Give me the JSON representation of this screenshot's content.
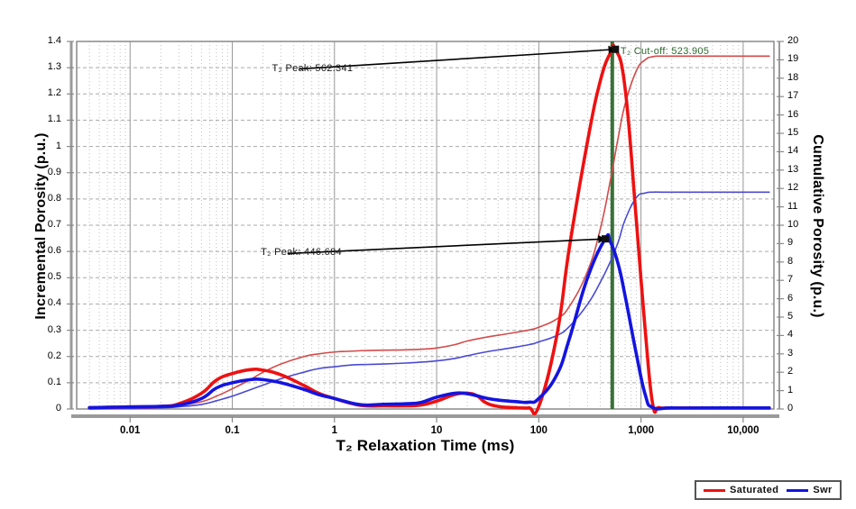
{
  "chart_data": {
    "type": "line",
    "title": "",
    "xlabel": "T₂ Relaxation Time (ms)",
    "ylabel": "Incremental Porosity (p.u.)",
    "ylabel_right": "Cumulative Porosity (p.u.)",
    "xscale": "log",
    "xlim": [
      0.003,
      20000
    ],
    "ylim": [
      0,
      1.4
    ],
    "ylim_right": [
      0,
      20
    ],
    "grid": true,
    "legend_position": "bottom-right",
    "xtick_labels": [
      "0.01",
      "0.1",
      "1",
      "10",
      "100",
      "1,000",
      "10,000"
    ],
    "xtick_values": [
      0.01,
      0.1,
      1,
      10,
      100,
      1000,
      10000
    ],
    "ytick_labels_left": [
      "0",
      "0.1",
      "0.2",
      "0.3",
      "0.4",
      "0.5",
      "0.6",
      "0.7",
      "0.8",
      "0.9",
      "1",
      "1.1",
      "1.2",
      "1.3",
      "1.4"
    ],
    "ytick_values_left": [
      0,
      0.1,
      0.2,
      0.3,
      0.4,
      0.5,
      0.6,
      0.7,
      0.8,
      0.9,
      1.0,
      1.1,
      1.2,
      1.3,
      1.4
    ],
    "ytick_labels_right": [
      "0",
      "1",
      "2",
      "3",
      "4",
      "5",
      "6",
      "7",
      "8",
      "9",
      "10",
      "11",
      "12",
      "13",
      "14",
      "15",
      "16",
      "17",
      "18",
      "19",
      "20"
    ],
    "ytick_values_right": [
      0,
      1,
      2,
      3,
      4,
      5,
      6,
      7,
      8,
      9,
      10,
      11,
      12,
      13,
      14,
      15,
      16,
      17,
      18,
      19,
      20
    ],
    "series": [
      {
        "name": "Saturated",
        "kind": "incremental",
        "color": "#ee1111",
        "axis": "left",
        "x": [
          0.004,
          0.01,
          0.02,
          0.03,
          0.05,
          0.07,
          0.1,
          0.15,
          0.2,
          0.3,
          0.5,
          0.7,
          1.0,
          1.5,
          2.0,
          3.0,
          5.0,
          7.0,
          10.0,
          15.0,
          20.0,
          25.0,
          30.0,
          40.0,
          60.0,
          80.0,
          100.0,
          150.0,
          200.0,
          300.0,
          400.0,
          500.0,
          562.341,
          700.0,
          900.0,
          1100.0,
          1300.0,
          1500.0,
          2000.0,
          5000.0,
          10000.0,
          18000.0
        ],
        "y": [
          0.005,
          0.008,
          0.01,
          0.02,
          0.06,
          0.11,
          0.135,
          0.15,
          0.148,
          0.13,
          0.09,
          0.06,
          0.04,
          0.02,
          0.012,
          0.012,
          0.012,
          0.015,
          0.03,
          0.055,
          0.06,
          0.05,
          0.025,
          0.01,
          0.005,
          0.004,
          0.01,
          0.28,
          0.62,
          1.02,
          1.25,
          1.355,
          1.37,
          1.22,
          0.72,
          0.3,
          0.02,
          0.005,
          0.004,
          0.004,
          0.004,
          0.004
        ]
      },
      {
        "name": "Swr",
        "kind": "incremental",
        "color": "#1414e0",
        "axis": "left",
        "x": [
          0.004,
          0.01,
          0.02,
          0.03,
          0.05,
          0.07,
          0.1,
          0.15,
          0.2,
          0.3,
          0.5,
          0.7,
          1.0,
          1.5,
          2.0,
          3.0,
          5.0,
          7.0,
          10.0,
          15.0,
          20.0,
          25.0,
          30.0,
          40.0,
          60.0,
          80.0,
          100.0,
          150.0,
          200.0,
          300.0,
          446.684,
          500.0,
          600.0,
          700.0,
          900.0,
          1100.0,
          1300.0,
          2000.0,
          5000.0,
          10000.0,
          18000.0
        ],
        "y": [
          0.005,
          0.008,
          0.01,
          0.015,
          0.04,
          0.08,
          0.1,
          0.112,
          0.112,
          0.1,
          0.075,
          0.055,
          0.04,
          0.022,
          0.015,
          0.018,
          0.02,
          0.025,
          0.045,
          0.06,
          0.058,
          0.05,
          0.042,
          0.034,
          0.028,
          0.026,
          0.04,
          0.13,
          0.27,
          0.5,
          0.648,
          0.638,
          0.55,
          0.43,
          0.21,
          0.055,
          0.006,
          0.004,
          0.004,
          0.004,
          0.004
        ]
      },
      {
        "name": "Saturated cumulative",
        "kind": "cumulative",
        "color": "#d44a4a",
        "axis": "right",
        "x": [
          0.004,
          0.01,
          0.02,
          0.03,
          0.05,
          0.07,
          0.1,
          0.15,
          0.2,
          0.3,
          0.5,
          0.7,
          1.0,
          1.5,
          2.0,
          3.0,
          5.0,
          7.0,
          10.0,
          15.0,
          20.0,
          30.0,
          50.0,
          80.0,
          100.0,
          150.0,
          200.0,
          300.0,
          400.0,
          500.0,
          600.0,
          700.0,
          900.0,
          1100.0,
          1300.0,
          1600.0,
          2500.0,
          5000.0,
          10000.0,
          18000.0
        ],
        "y": [
          0.0,
          0.05,
          0.1,
          0.2,
          0.4,
          0.7,
          1.1,
          1.6,
          2.0,
          2.45,
          2.85,
          3.0,
          3.1,
          3.15,
          3.18,
          3.2,
          3.22,
          3.25,
          3.32,
          3.5,
          3.7,
          3.9,
          4.1,
          4.3,
          4.45,
          4.9,
          5.6,
          7.5,
          9.8,
          12.4,
          14.8,
          16.6,
          18.4,
          19.0,
          19.17,
          19.2,
          19.2,
          19.2,
          19.2,
          19.2
        ]
      },
      {
        "name": "Swr cumulative",
        "kind": "cumulative",
        "color": "#4a4ad4",
        "axis": "right",
        "x": [
          0.004,
          0.01,
          0.02,
          0.03,
          0.05,
          0.07,
          0.1,
          0.15,
          0.2,
          0.3,
          0.5,
          0.7,
          1.0,
          1.5,
          2.0,
          3.0,
          5.0,
          7.0,
          10.0,
          15.0,
          20.0,
          30.0,
          50.0,
          80.0,
          100.0,
          150.0,
          200.0,
          300.0,
          400.0,
          500.0,
          600.0,
          700.0,
          900.0,
          1100.0,
          1300.0,
          1600.0,
          2500.0,
          5000.0,
          10000.0,
          18000.0
        ],
        "y": [
          0.0,
          0.03,
          0.06,
          0.12,
          0.25,
          0.45,
          0.7,
          1.05,
          1.3,
          1.65,
          2.0,
          2.2,
          2.3,
          2.4,
          2.42,
          2.45,
          2.5,
          2.55,
          2.62,
          2.75,
          2.9,
          3.1,
          3.3,
          3.5,
          3.65,
          4.0,
          4.5,
          5.7,
          6.9,
          8.0,
          9.1,
          10.3,
          11.5,
          11.75,
          11.8,
          11.8,
          11.8,
          11.8,
          11.8,
          11.8
        ]
      }
    ],
    "markers": [
      {
        "name": "t2-peak-saturated",
        "label": "T₂ Peak: 562.341",
        "x": 562.341,
        "y": 1.37,
        "color": "#000000",
        "label_x": 0.45,
        "label_y": 1.295
      },
      {
        "name": "t2-peak-swr",
        "label": "T₂ Peak: 446.684",
        "x": 446.684,
        "y": 0.648,
        "color": "#000000",
        "label_x": 0.35,
        "label_y": 0.592
      }
    ],
    "vline": {
      "name": "t2-cutoff",
      "label": "T₂ Cut-off: 523.905",
      "x": 523.905,
      "color": "#2d6a2d",
      "width": 4
    },
    "legend": [
      {
        "label": "Saturated",
        "color": "#ee1111"
      },
      {
        "label": "Swr",
        "color": "#1414e0"
      }
    ]
  }
}
